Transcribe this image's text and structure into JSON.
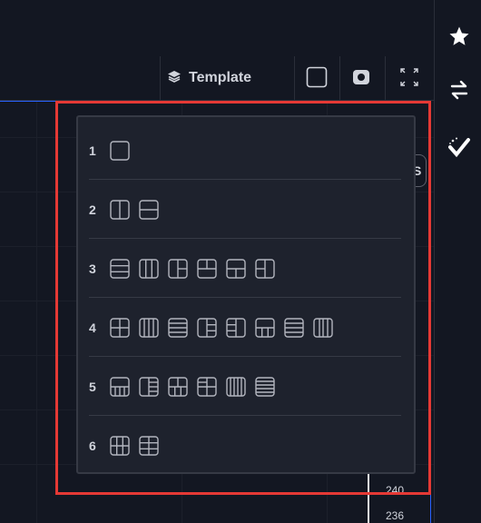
{
  "toolbar": {
    "template_label": "Template"
  },
  "price_axis": {
    "labels": [
      "240",
      "236"
    ]
  },
  "peek_label": "S",
  "layout_popup": {
    "rows": [
      {
        "count": "1",
        "layouts": [
          "single"
        ]
      },
      {
        "count": "2",
        "layouts": [
          "2-vertical",
          "2-horizontal"
        ]
      },
      {
        "count": "3",
        "layouts": [
          "3-rows",
          "3-columns",
          "3-left-big",
          "3-top-big",
          "3-bottom-big",
          "3-right-big"
        ]
      },
      {
        "count": "4",
        "layouts": [
          "4-grid",
          "4-columns",
          "4-rows",
          "4-left-big",
          "4-right-big",
          "4-bottom-big",
          "4-middle-rows",
          "4-cols-right"
        ]
      },
      {
        "count": "5",
        "layouts": [
          "5-bottom-big",
          "5-left-big",
          "5-top-two",
          "5-grid-cross",
          "5-columns",
          "5-rows"
        ]
      },
      {
        "count": "6",
        "layouts": [
          "6-grid-3x2",
          "6-grid-2x3"
        ]
      }
    ]
  },
  "colors": {
    "highlight": "#e53935",
    "accent": "#2962ff"
  }
}
